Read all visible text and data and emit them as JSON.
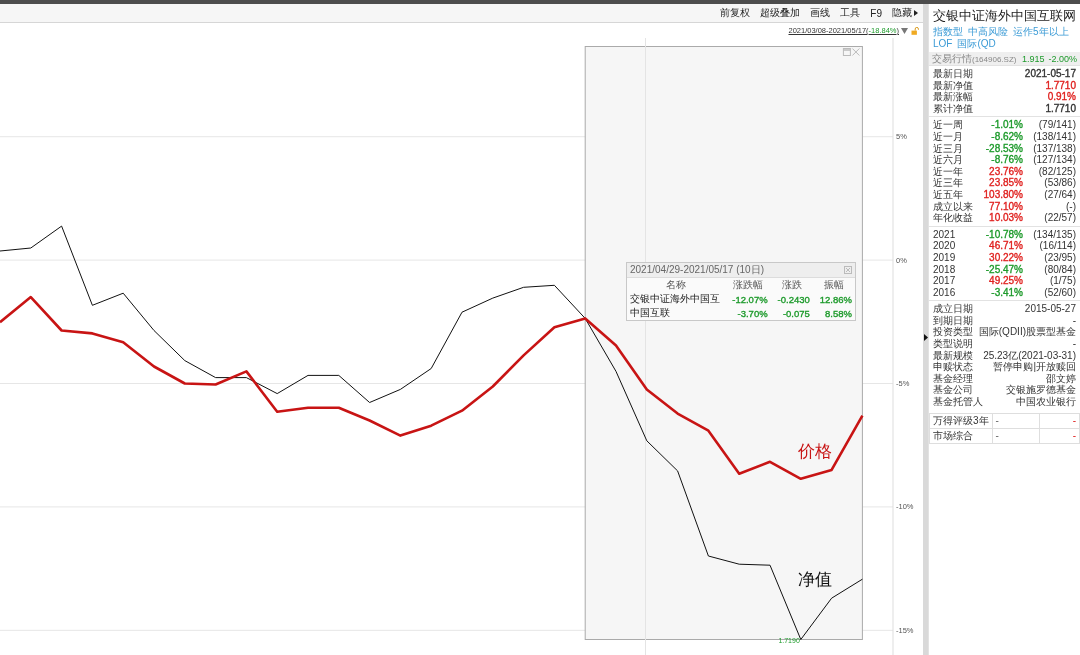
{
  "toolbar": {
    "items": [
      {
        "label": "前复权",
        "kind": "plain"
      },
      {
        "label": "超级叠加",
        "kind": "plain"
      },
      {
        "label": "画线",
        "kind": "plain"
      },
      {
        "label": "工具",
        "kind": "plain"
      },
      {
        "label": "F9",
        "kind": "plain"
      },
      {
        "label": "隐藏",
        "kind": "menu"
      }
    ]
  },
  "date_range": {
    "text_before": "2021/03/08-2021/05/17(",
    "change": "-18.84%",
    "text_after": ")"
  },
  "chart": {
    "chart_data": {
      "type": "line",
      "ylim": [
        -16,
        9
      ],
      "grid": true,
      "yticks": [
        {
          "value": 5,
          "label": "5%"
        },
        {
          "value": 0,
          "label": "0%"
        },
        {
          "value": -5,
          "label": "-5%"
        },
        {
          "value": -10,
          "label": "-10%"
        },
        {
          "value": -15,
          "label": "-15%"
        }
      ],
      "series": [
        {
          "name": "净值",
          "color": "#111111",
          "values": [
            0.37,
            0.49,
            1.38,
            -1.83,
            -1.34,
            -2.85,
            -4.07,
            -4.76,
            -4.76,
            -5.41,
            -4.67,
            -4.67,
            -5.77,
            -5.24,
            -4.39,
            -2.11,
            -1.54,
            -1.1,
            -1.02,
            -2.36,
            -4.51,
            -7.32,
            -8.54,
            -11.99,
            -12.32,
            -12.36,
            -15.37,
            -13.7,
            -12.93
          ]
        },
        {
          "name": "价格",
          "color": "#c81414",
          "values": [
            -2.52,
            -1.5,
            -2.85,
            -2.97,
            -3.33,
            -4.31,
            -5.0,
            -5.04,
            -4.51,
            -6.14,
            -5.98,
            -5.98,
            -6.5,
            -7.11,
            -6.71,
            -6.1,
            -5.12,
            -3.86,
            -2.72,
            -2.36,
            -3.46,
            -5.24,
            -6.22,
            -6.91,
            -8.66,
            -8.17,
            -8.86,
            -8.5,
            -6.3
          ]
        }
      ],
      "annotations": [
        "1.7190"
      ]
    },
    "selection_stats": {
      "title": "2021/04/29-2021/05/17 (10日)",
      "columns": [
        "名称",
        "涨跌幅",
        "涨跌",
        "振幅"
      ],
      "rows": [
        {
          "name": "交银中证海外中国互",
          "change_pct": "-12.07%",
          "change": "-0.2430",
          "amplitude": "12.86%",
          "color": "#1d9a2b"
        },
        {
          "name": "中国互联",
          "change_pct": "-3.70%",
          "change": "-0.075",
          "amplitude": "8.58%",
          "color": "#1d9a2b"
        }
      ]
    }
  },
  "fund_panel": {
    "title": "交银中证海外中国互联网",
    "tags": [
      "指数型",
      "中高风险",
      "运作5年以上",
      "LOF",
      "国际(QD"
    ],
    "quote": {
      "label": "交易行情",
      "code": "(164906.SZ)",
      "price": "1.915",
      "change": "-2.00%"
    },
    "latest": [
      {
        "label": "最新日期",
        "value": "2021-05-17",
        "color": "#333333"
      },
      {
        "label": "最新净值",
        "value": "1.7710",
        "color": "#e0211f"
      },
      {
        "label": "最新涨幅",
        "value": "0.91%",
        "color": "#e0211f"
      },
      {
        "label": "累计净值",
        "value": "1.7710",
        "color": "#333333"
      }
    ],
    "returns": [
      {
        "label": "近一周",
        "change": "-1.01%",
        "rank": "(79/141)",
        "color": "#1d9a2b"
      },
      {
        "label": "近一月",
        "change": "-8.62%",
        "rank": "(138/141)",
        "color": "#1d9a2b"
      },
      {
        "label": "近三月",
        "change": "-28.53%",
        "rank": "(137/138)",
        "color": "#1d9a2b"
      },
      {
        "label": "近六月",
        "change": "-8.76%",
        "rank": "(127/134)",
        "color": "#1d9a2b"
      },
      {
        "label": "近一年",
        "change": "23.76%",
        "rank": "(82/125)",
        "color": "#e0211f"
      },
      {
        "label": "近三年",
        "change": "23.85%",
        "rank": "(53/86)",
        "color": "#e0211f"
      },
      {
        "label": "近五年",
        "change": "103.80%",
        "rank": "(27/64)",
        "color": "#e0211f"
      },
      {
        "label": "成立以来",
        "change": "77.10%",
        "rank": "(-)",
        "color": "#e0211f"
      },
      {
        "label": "年化收益",
        "change": "10.03%",
        "rank": "(22/57)",
        "color": "#e0211f"
      }
    ],
    "yearly": [
      {
        "label": "2021",
        "change": "-10.78%",
        "rank": "(134/135)",
        "color": "#1d9a2b"
      },
      {
        "label": "2020",
        "change": "46.71%",
        "rank": "(16/114)",
        "color": "#e0211f"
      },
      {
        "label": "2019",
        "change": "30.22%",
        "rank": "(23/95)",
        "color": "#e0211f"
      },
      {
        "label": "2018",
        "change": "-25.47%",
        "rank": "(80/84)",
        "color": "#1d9a2b"
      },
      {
        "label": "2017",
        "change": "49.25%",
        "rank": "(1/75)",
        "color": "#e0211f"
      },
      {
        "label": "2016",
        "change": "-3.41%",
        "rank": "(52/60)",
        "color": "#1d9a2b"
      }
    ],
    "profile": [
      {
        "label": "成立日期",
        "value": "2015-05-27"
      },
      {
        "label": "到期日期",
        "value": "-"
      },
      {
        "label": "投资类型",
        "value": "国际(QDII)股票型基金"
      },
      {
        "label": "类型说明",
        "value": "-"
      },
      {
        "label": "最新规模",
        "value": "25.23亿(2021-03-31)"
      },
      {
        "label": "申赎状态",
        "value": "暂停申购|开放赎回"
      },
      {
        "label": "基金经理",
        "value": "邵文婷"
      },
      {
        "label": "基金公司",
        "value": "交银施罗德基金"
      },
      {
        "label": "基金托管人",
        "value": "中国农业银行"
      }
    ],
    "rating_table": {
      "rows": [
        {
          "cells": [
            "万得评级3年",
            "-",
            "-"
          ]
        },
        {
          "cells": [
            "市场综合",
            "-",
            "-"
          ]
        }
      ]
    }
  }
}
